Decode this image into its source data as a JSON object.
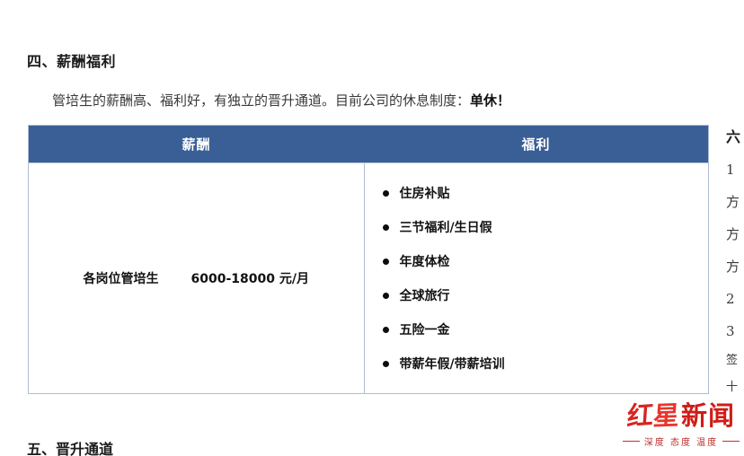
{
  "document": {
    "section_heading": "四、薪酬福利",
    "intro_text": "管培生的薪酬高、福利好，有独立的晋升通道。目前公司的休息制度：",
    "intro_emphasis": "单休！",
    "bottom_heading": "五、晋升通道"
  },
  "table": {
    "headers": {
      "salary": "薪酬",
      "benefit": "福利"
    },
    "salary_row": {
      "position": "各岗位管培生",
      "range": "6000-18000 元/月"
    },
    "benefits": [
      "住房补贴",
      "三节福利/生日假",
      "年度体检",
      "全球旅行",
      "五险一金",
      "带薪年假/带薪培训"
    ],
    "colors": {
      "header_background": "#3a5f96",
      "header_text": "#ffffff",
      "border": "#aebcd4"
    }
  },
  "right_column": {
    "lines": [
      "六",
      "1",
      "方",
      "方",
      "方",
      "2",
      "3",
      "签",
      "十"
    ]
  },
  "watermark": {
    "brand_chars": [
      "红",
      "星",
      "新",
      "闻"
    ],
    "tagline": "深度 态度 温度",
    "color": "#cf1d19"
  }
}
